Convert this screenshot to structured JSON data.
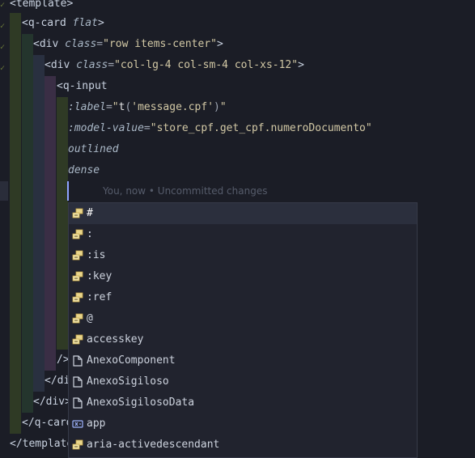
{
  "editor": {
    "lines": [
      {
        "parts": [
          {
            "t": "<template>",
            "c": "tag"
          }
        ]
      },
      {
        "parts": [
          {
            "t": "<q-card ",
            "c": "tag"
          },
          {
            "t": "flat",
            "c": "attr"
          },
          {
            "t": ">",
            "c": "tag"
          }
        ]
      },
      {
        "parts": [
          {
            "t": "<div ",
            "c": "tag"
          },
          {
            "t": "class",
            "c": "attr"
          },
          {
            "t": "=",
            "c": "dim"
          },
          {
            "t": "\"row items-center\"",
            "c": "str"
          },
          {
            "t": ">",
            "c": "tag"
          }
        ]
      },
      {
        "parts": [
          {
            "t": "<div ",
            "c": "tag"
          },
          {
            "t": "class",
            "c": "attr"
          },
          {
            "t": "=",
            "c": "dim"
          },
          {
            "t": "\"col-lg-4 col-sm-4 col-xs-12\"",
            "c": "str"
          },
          {
            "t": ">",
            "c": "tag"
          }
        ]
      },
      {
        "parts": [
          {
            "t": "<q-input",
            "c": "tag"
          }
        ]
      },
      {
        "parts": [
          {
            "t": ":label",
            "c": "attr"
          },
          {
            "t": "=",
            "c": "dim"
          },
          {
            "t": "\"",
            "c": "str"
          },
          {
            "t": "t",
            "c": "fn"
          },
          {
            "t": "(",
            "c": "dim"
          },
          {
            "t": "'message.cpf'",
            "c": "str"
          },
          {
            "t": ")",
            "c": "dim"
          },
          {
            "t": "\"",
            "c": "str"
          }
        ]
      },
      {
        "parts": [
          {
            "t": ":model-value",
            "c": "attr"
          },
          {
            "t": "=",
            "c": "dim"
          },
          {
            "t": "\"store_cpf.get_cpf.numeroDocumento\"",
            "c": "str"
          }
        ]
      },
      {
        "parts": [
          {
            "t": "outlined",
            "c": "attr"
          }
        ]
      },
      {
        "parts": [
          {
            "t": "dense",
            "c": "attr"
          }
        ]
      },
      {
        "parts": []
      },
      {
        "parts": []
      },
      {
        "parts": []
      },
      {
        "parts": []
      },
      {
        "parts": []
      },
      {
        "parts": []
      },
      {
        "parts": []
      },
      {
        "parts": []
      },
      {
        "parts": [
          {
            "t": "/>",
            "c": "tag"
          }
        ]
      },
      {
        "parts": [
          {
            "t": "</di",
            "c": "tag"
          }
        ]
      },
      {
        "parts": [
          {
            "t": "</div>",
            "c": "tag"
          }
        ]
      },
      {
        "parts": [
          {
            "t": "</q-card",
            "c": "tag"
          }
        ]
      },
      {
        "parts": [
          {
            "t": "</template",
            "c": "tag"
          }
        ]
      }
    ],
    "blame_text": "You, now • Uncommitted changes"
  },
  "suggest": {
    "items": [
      {
        "label": "#",
        "icon": "property-icon",
        "selected": true
      },
      {
        "label": ":",
        "icon": "property-icon"
      },
      {
        "label": ":is",
        "icon": "property-icon"
      },
      {
        "label": ":key",
        "icon": "property-icon"
      },
      {
        "label": ":ref",
        "icon": "property-icon"
      },
      {
        "label": "@",
        "icon": "property-icon"
      },
      {
        "label": "accesskey",
        "icon": "property-icon"
      },
      {
        "label": "AnexoComponent",
        "icon": "file-icon"
      },
      {
        "label": "AnexoSigiloso",
        "icon": "file-icon"
      },
      {
        "label": "AnexoSigilosoData",
        "icon": "file-icon"
      },
      {
        "label": "app",
        "icon": "variable-icon"
      },
      {
        "label": "aria-activedescendant",
        "icon": "property-icon"
      }
    ]
  },
  "colors": {
    "background": "#1b1d26",
    "indent_guides": [
      "#2f3a25",
      "#24352d",
      "#293040",
      "#3a2e45",
      "#2f3a25"
    ],
    "caret": "#8fa3ff"
  }
}
